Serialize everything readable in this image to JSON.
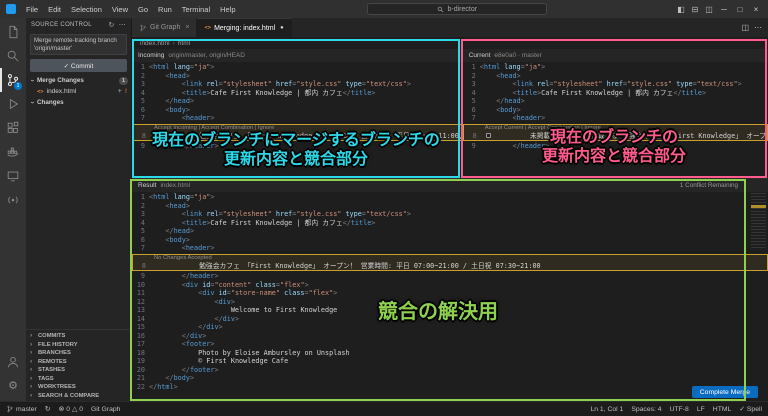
{
  "titlebar": {
    "menus": [
      "File",
      "Edit",
      "Selection",
      "View",
      "Go",
      "Run",
      "Terminal",
      "Help"
    ],
    "search_value": "b-director",
    "window_controls": {
      "minimize": "─",
      "maximize": "□",
      "close": "×"
    }
  },
  "activitybar": {
    "icons": [
      "explorer",
      "search",
      "source-control",
      "run-and-debug",
      "extensions",
      "docker",
      "remote-explorer",
      "live-preview",
      "account",
      "settings"
    ],
    "source_control_badge": "1"
  },
  "sidebar": {
    "title": "SOURCE CONTROL",
    "commit_message": "Merge remote-tracking branch 'origin/master'",
    "commit_button": "✓ Commit",
    "merge_changes": {
      "label": "Merge Changes",
      "count": "1"
    },
    "merge_files": [
      {
        "name": "index.html",
        "status": "!"
      }
    ],
    "changes": {
      "label": "Changes"
    },
    "panels": [
      "COMMITS",
      "FILE HISTORY",
      "BRANCHES",
      "REMOTES",
      "STASHES",
      "TAGS",
      "WORKTREES",
      "SEARCH & COMPARE"
    ]
  },
  "tabs": [
    {
      "label": "Git Graph"
    },
    {
      "label": "Merging: index.html"
    }
  ],
  "breadcrumb": [
    "index.html",
    "html"
  ],
  "editors": {
    "incoming": {
      "title": "Incoming",
      "detail": "origin/master, origin/HEAD",
      "lens": "Accept Incoming | Accept Combination | Ignore",
      "lines": [
        {
          "n": 1,
          "t": "<html lang=\"ja\">"
        },
        {
          "n": 2,
          "t": "    <head>"
        },
        {
          "n": 3,
          "t": "        <link rel=\"stylesheet\" href=\"style.css\" type=\"text/css\">"
        },
        {
          "n": 4,
          "t": "        <title>Cafe First Knowledge | 都内 カフェ</title>"
        },
        {
          "n": 5,
          "t": "    </head>"
        },
        {
          "n": 6,
          "t": "    <body>"
        },
        {
          "n": 7,
          "t": "        <header>"
        },
        {
          "n": 8,
          "t": "            勉強会カフェ 「First Knowledge」 オープン！ 営業時間: 平日 07:00~11:00, 18:00~21:00",
          "c": true
        },
        {
          "n": 9,
          "t": "        </header>"
        }
      ]
    },
    "current": {
      "title": "Current",
      "detail": "e8e0a0 · master",
      "lens": "Accept Current | Accept Combination | Ignore",
      "lines": [
        {
          "n": 1,
          "t": "<html lang=\"ja\">"
        },
        {
          "n": 2,
          "t": "    <head>"
        },
        {
          "n": 3,
          "t": "        <link rel=\"stylesheet\" href=\"style.css\" type=\"text/css\">"
        },
        {
          "n": 4,
          "t": "        <title>Cafe First Knowledge | 都内 カフェ</title>"
        },
        {
          "n": 5,
          "t": "    </head>"
        },
        {
          "n": 6,
          "t": "    <body>"
        },
        {
          "n": 7,
          "t": "        <header>"
        },
        {
          "n": 8,
          "t": "            未掲載のお知らせを掲載する 勉強会カフェ 「First Knowledge」 オープン！ 営業時間: 平日 07:00~11:00, 18:00~21:00",
          "c": true
        },
        {
          "n": 9,
          "t": "        </header>"
        }
      ]
    },
    "result": {
      "title": "Result",
      "detail": "index.html",
      "conflict_status": "1 Conflict Remaining",
      "lens": "No Changes Accepted",
      "complete_button": "Complete Merge",
      "lines": [
        {
          "n": 1,
          "t": "<html lang=\"ja\">"
        },
        {
          "n": 2,
          "t": "    <head>"
        },
        {
          "n": 3,
          "t": "        <link rel=\"stylesheet\" href=\"style.css\" type=\"text/css\">"
        },
        {
          "n": 4,
          "t": "        <title>Cafe First Knowledge | 都内 カフェ</title>"
        },
        {
          "n": 5,
          "t": "    </head>"
        },
        {
          "n": 6,
          "t": "    <body>"
        },
        {
          "n": 7,
          "t": "        <header>"
        },
        {
          "n": 8,
          "t": "            勉強会カフェ 「First Knowledge」 オープン！ 営業時間: 平日 07:00~21:00 / 土日祝 07:30~21:00",
          "c": true
        },
        {
          "n": 9,
          "t": "        </header>"
        },
        {
          "n": 10,
          "t": "        <div id=\"content\" class=\"flex\">"
        },
        {
          "n": 11,
          "t": "            <div id=\"store-name\" class=\"flex\">"
        },
        {
          "n": 12,
          "t": "                <div>"
        },
        {
          "n": 13,
          "t": "                    Welcome to First Knowledge"
        },
        {
          "n": 14,
          "t": "                </div>"
        },
        {
          "n": 15,
          "t": "            </div>"
        },
        {
          "n": 16,
          "t": "        </div>"
        },
        {
          "n": 17,
          "t": "        <footer>"
        },
        {
          "n": 18,
          "t": "            Photo by Eloise Ambursley on Unsplash"
        },
        {
          "n": 19,
          "t": "            © First Knowledge Cafe"
        },
        {
          "n": 20,
          "t": "        </footer>"
        },
        {
          "n": 21,
          "t": "    </body>"
        },
        {
          "n": 22,
          "t": "</html>"
        }
      ]
    }
  },
  "statusbar": {
    "branch": "master",
    "sync": "↻",
    "errors": "0",
    "warnings": "0",
    "git_graph": "Git Graph",
    "right": [
      "Ln 1, Col 1",
      "Spaces: 4",
      "UTF-8",
      "LF",
      "HTML",
      "✓ Spell"
    ]
  },
  "annotations": {
    "incoming": {
      "color": "#2bd9e8",
      "lines": [
        "現在のブランチにマージするブランチの",
        "更新内容と競合部分"
      ]
    },
    "current": {
      "color": "#ff5b8d",
      "lines": [
        "現在のブランチの",
        "更新内容と競合部分"
      ]
    },
    "result": {
      "color": "#8fd14f",
      "lines": [
        "競合の解決用"
      ]
    }
  }
}
